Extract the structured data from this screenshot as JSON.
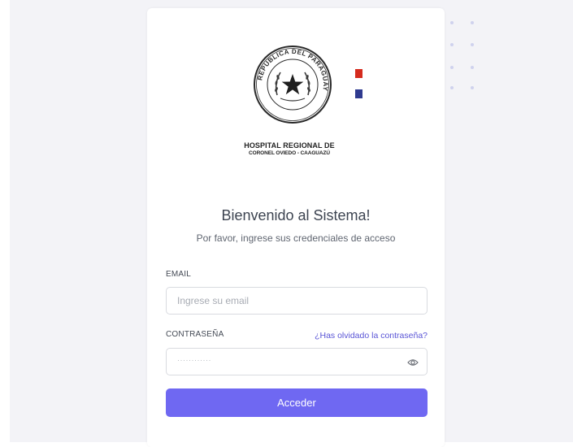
{
  "hospital": {
    "name_line1": "HOSPITAL REGIONAL DE",
    "name_line2": "CORONEL OVIEDO - CAAGUAZÚ",
    "seal_text": "REPUBLICA DEL PARAGUAY"
  },
  "colors": {
    "flag_red": "#d52b1e",
    "flag_blue": "#2f3a8f",
    "accent": "#6f68f2",
    "link": "#5a55d6"
  },
  "welcome": {
    "title": "Bienvenido al Sistema!",
    "subtitle": "Por favor, ingrese sus credenciales de acceso"
  },
  "form": {
    "email_label": "EMAIL",
    "email_placeholder": "Ingrese su email",
    "password_label": "CONTRASEÑA",
    "password_value": "············",
    "forgot_link": "¿Has olvidado la contraseña?",
    "submit_label": "Acceder"
  },
  "icons": {
    "password_toggle": "eye-icon",
    "decoration": "dot-grid"
  }
}
